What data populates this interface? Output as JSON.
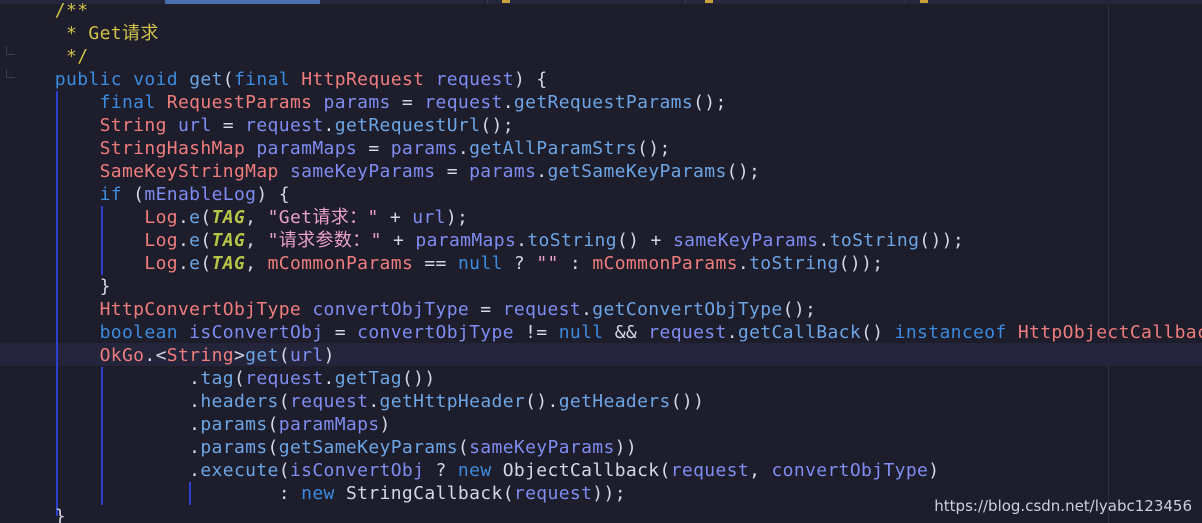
{
  "watermark": "https://blog.csdn.net/lyabc123456",
  "colors": {
    "background": "#1d1d2b",
    "keyword": "#3d8bdf",
    "type": "#ef7d7d",
    "identifier": "#7f8cf0",
    "method": "#6ca5e5",
    "static_field": "#b7c648",
    "string": "#e9a0cc",
    "comment": "#d1c24a",
    "indent_guide": "#2c3fd0"
  },
  "code": {
    "l1": {
      "c": "/**"
    },
    "l2": {
      "c": "* Get请求"
    },
    "l3": {
      "c": "*/"
    },
    "l4": {
      "kw1": "public",
      "kw2": "void",
      "m": "get",
      "p1": "(",
      "kw3": "final",
      "t": "HttpRequest",
      "i": "request",
      "p2": ") {"
    },
    "l5": {
      "kw": "final",
      "t": "RequestParams",
      "i1": "params",
      "op": " = ",
      "i2": "request",
      "dot": ".",
      "m": "getRequestParams",
      "end": "();"
    },
    "l6": {
      "t": "String",
      "i1": "url",
      "op": " = ",
      "i2": "request",
      "dot": ".",
      "m": "getRequestUrl",
      "end": "();"
    },
    "l7": {
      "t": "StringHashMap",
      "i1": "paramMaps",
      "op": " = ",
      "i2": "params",
      "dot": ".",
      "m": "getAllParamStrs",
      "end": "();"
    },
    "l8": {
      "t": "SameKeyStringMap",
      "i1": "sameKeyParams",
      "op": " = ",
      "i2": "params",
      "dot": ".",
      "m": "getSameKeyParams",
      "end": "();"
    },
    "l9": {
      "kw": "if",
      "p1": " (",
      "i": "mEnableLog",
      "p2": ") {"
    },
    "l10": {
      "t": "Log",
      "dot": ".",
      "m": "e",
      "p1": "(",
      "s": "TAG",
      "comma": ", ",
      "str": "\"Get请求：\"",
      "op": " + ",
      "i": "url",
      "end": ");"
    },
    "l11": {
      "t": "Log",
      "dot1": ".",
      "m1": "e",
      "p1": "(",
      "s": "TAG",
      "comma": ", ",
      "str": "\"请求参数：\"",
      "op1": " + ",
      "i1": "paramMaps",
      "dot2": ".",
      "m2": "toString",
      "mid": "() + ",
      "i2": "sameKeyParams",
      "dot3": ".",
      "m3": "toString",
      "end": "());"
    },
    "l12": {
      "t": "Log",
      "dot1": ".",
      "m1": "e",
      "p1": "(",
      "s": "TAG",
      "comma": ", ",
      "i1": "mCommonParams",
      "op1": " == ",
      "kw": "null",
      "q": " ? ",
      "str": "\"\"",
      "colon": " : ",
      "i2": "mCommonParams",
      "dot2": ".",
      "m2": "toString",
      "end": "());"
    },
    "l13": {
      "c": "}"
    },
    "l14": {
      "t": "HttpConvertObjType",
      "i1": "convertObjType",
      "op": " = ",
      "i2": "request",
      "dot": ".",
      "m": "getConvertObjType",
      "end": "();"
    },
    "l15": {
      "kw1": "boolean",
      "i1": "isConvertObj",
      "op1": " = ",
      "i2": "convertObjType",
      "op2": " != ",
      "kw2": "null",
      "op3": " && ",
      "i3": "request",
      "dot": ".",
      "m": "getCallBack",
      "p": "() ",
      "kw3": "instanceof",
      "t": "HttpObjectCallback"
    },
    "l16": {
      "t1": "OkGo",
      "p1": ".<",
      "t2": "String",
      "p2": ">",
      "m": "get",
      "p3": "(",
      "i": "url",
      "p4": ")"
    },
    "l17": {
      "dot": ".",
      "m1": "tag",
      "p1": "(",
      "i": "request",
      "dot2": ".",
      "m2": "getTag",
      "end": "())"
    },
    "l18": {
      "dot": ".",
      "m1": "headers",
      "p1": "(",
      "i": "request",
      "dot2": ".",
      "m2": "getHttpHeader",
      "mid": "().",
      "m3": "getHeaders",
      "end": "())"
    },
    "l19": {
      "dot": ".",
      "m": "params",
      "p1": "(",
      "i": "paramMaps",
      "end": ")"
    },
    "l20": {
      "dot": ".",
      "m1": "params",
      "p1": "(",
      "m2": "getSameKeyParams",
      "p2": "(",
      "i": "sameKeyParams",
      "end": "))"
    },
    "l21": {
      "dot": ".",
      "m": "execute",
      "p1": "(",
      "i1": "isConvertObj",
      "q": " ? ",
      "kw": "new",
      "t": "ObjectCallback",
      "p2": "(",
      "i2": "request",
      "comma": ", ",
      "i3": "convertObjType",
      "end": ")"
    },
    "l22": {
      "colon": ": ",
      "kw": "new",
      "t": "StringCallback",
      "p1": "(",
      "i": "request",
      "end": "));"
    },
    "l23": {
      "c": "}"
    }
  }
}
